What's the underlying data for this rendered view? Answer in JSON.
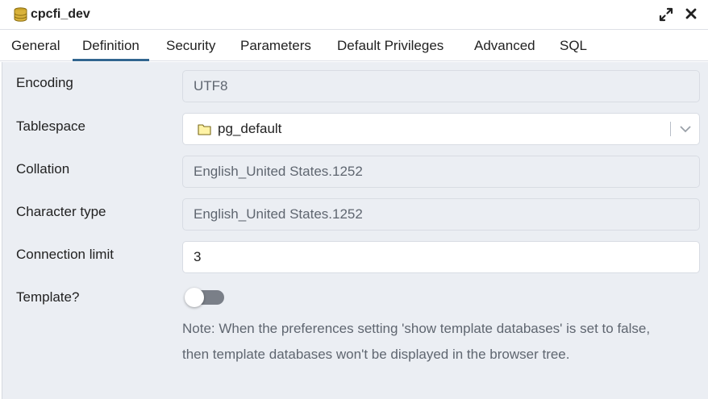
{
  "window": {
    "title": "cpcfi_dev",
    "icons": {
      "title_icon": "database-icon",
      "expand": "expand-icon",
      "close": "close-icon"
    }
  },
  "tabs": [
    {
      "label": "General"
    },
    {
      "label": "Definition",
      "active": true
    },
    {
      "label": "Security"
    },
    {
      "label": "Parameters"
    },
    {
      "label": "Default Privileges"
    },
    {
      "label": "Advanced"
    },
    {
      "label": "SQL"
    }
  ],
  "form": {
    "encoding": {
      "label": "Encoding",
      "value": "UTF8"
    },
    "tablespace": {
      "label": "Tablespace",
      "value": "pg_default",
      "icon": "folder-icon"
    },
    "collation": {
      "label": "Collation",
      "value": "English_United States.1252"
    },
    "character_type": {
      "label": "Character type",
      "value": "English_United States.1252"
    },
    "connection_limit": {
      "label": "Connection limit",
      "value": "3"
    },
    "template": {
      "label": "Template?",
      "enabled": false
    },
    "note_line1": "Note: When the preferences setting 'show template databases' is set to false,",
    "note_line2": "then template databases won't be displayed in the browser tree."
  },
  "colors": {
    "accent": "#326690",
    "panel_bg": "#ebeef3",
    "toggle_off": "#7a7f88",
    "folder_fill": "#fff3a6"
  }
}
